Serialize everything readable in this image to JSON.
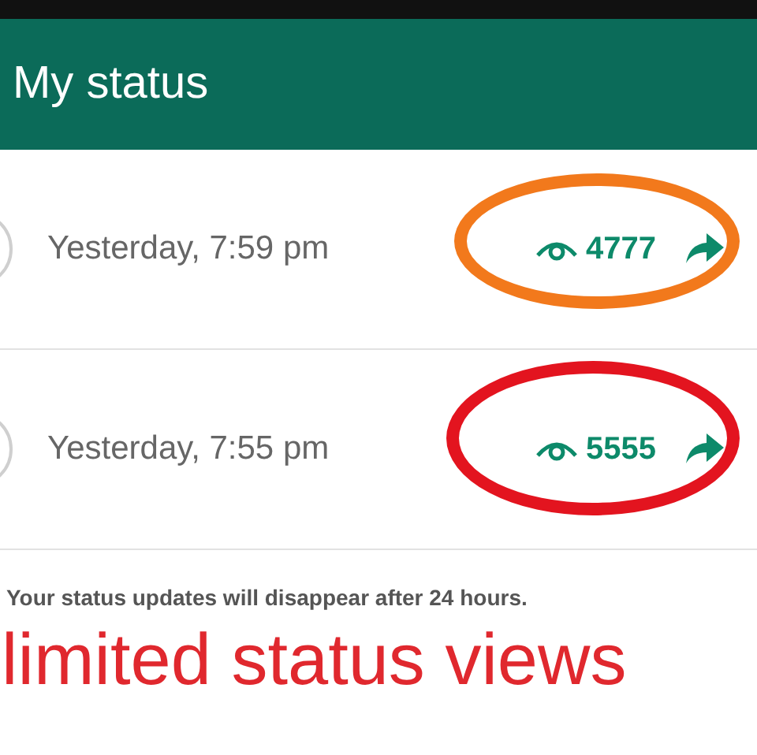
{
  "header": {
    "title": "My status"
  },
  "updates": [
    {
      "time": "Yesterday, 7:59 pm",
      "views": "4777",
      "color": "#f2791c"
    },
    {
      "time": "Yesterday, 7:55 pm",
      "views": "5555",
      "color": "#e3141f"
    }
  ],
  "notice": "Your status updates will disappear after 24 hours.",
  "caption": "limited status views"
}
